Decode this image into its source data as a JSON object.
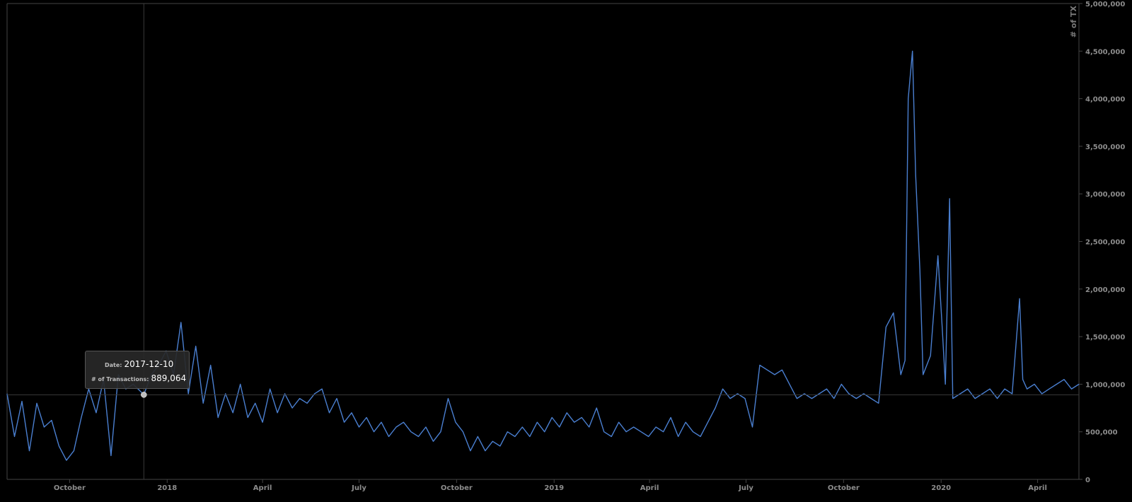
{
  "chart_data": {
    "type": "line",
    "ylabel": "# of TX",
    "ylim": [
      0,
      5000000
    ],
    "y_ticks": [
      "0",
      "500,000",
      "1,000,000",
      "1,500,000",
      "2,000,000",
      "2,500,000",
      "3,000,000",
      "3,500,000",
      "4,000,000",
      "4,500,000",
      "5,000,000"
    ],
    "y_tick_values": [
      0,
      500000,
      1000000,
      1500000,
      2000000,
      2500000,
      3000000,
      3500000,
      4000000,
      4500000,
      5000000
    ],
    "xlim": [
      "2017-08-03",
      "2020-05-10"
    ],
    "x_ticks": [
      {
        "label": "October",
        "date": "2017-10-01"
      },
      {
        "label": "2018",
        "date": "2018-01-01"
      },
      {
        "label": "April",
        "date": "2018-04-01"
      },
      {
        "label": "July",
        "date": "2018-07-01"
      },
      {
        "label": "October",
        "date": "2018-10-01"
      },
      {
        "label": "2019",
        "date": "2019-01-01"
      },
      {
        "label": "April",
        "date": "2019-04-01"
      },
      {
        "label": "July",
        "date": "2019-07-01"
      },
      {
        "label": "October",
        "date": "2019-10-01"
      },
      {
        "label": "2020",
        "date": "2020-01-01"
      },
      {
        "label": "April",
        "date": "2020-04-01"
      }
    ],
    "grid": false,
    "colors": {
      "line": "#4a7fd0",
      "crosshair": "#3a3a3a",
      "marker": "#bfbfbf",
      "axis": "#444444"
    },
    "series": [
      {
        "x": [
          "2017-08-03",
          "2017-08-10",
          "2017-08-17",
          "2017-08-24",
          "2017-08-31",
          "2017-09-07",
          "2017-09-14",
          "2017-09-21",
          "2017-09-28",
          "2017-10-05",
          "2017-10-12",
          "2017-10-19",
          "2017-10-26",
          "2017-11-02",
          "2017-11-09",
          "2017-11-16",
          "2017-11-23",
          "2017-11-30",
          "2017-12-10",
          "2017-12-17",
          "2017-12-24",
          "2017-12-31",
          "2018-01-07",
          "2018-01-14",
          "2018-01-21",
          "2018-01-28",
          "2018-02-04",
          "2018-02-11",
          "2018-02-18",
          "2018-02-25",
          "2018-03-04",
          "2018-03-11",
          "2018-03-18",
          "2018-03-25",
          "2018-04-01",
          "2018-04-08",
          "2018-04-15",
          "2018-04-22",
          "2018-04-29",
          "2018-05-06",
          "2018-05-13",
          "2018-05-20",
          "2018-05-27",
          "2018-06-03",
          "2018-06-10",
          "2018-06-17",
          "2018-06-24",
          "2018-07-01",
          "2018-07-08",
          "2018-07-15",
          "2018-07-22",
          "2018-07-29",
          "2018-08-05",
          "2018-08-12",
          "2018-08-19",
          "2018-08-26",
          "2018-09-02",
          "2018-09-09",
          "2018-09-16",
          "2018-09-23",
          "2018-09-30",
          "2018-10-07",
          "2018-10-14",
          "2018-10-21",
          "2018-10-28",
          "2018-11-04",
          "2018-11-11",
          "2018-11-18",
          "2018-11-25",
          "2018-12-02",
          "2018-12-09",
          "2018-12-16",
          "2018-12-23",
          "2018-12-30",
          "2019-01-06",
          "2019-01-13",
          "2019-01-20",
          "2019-01-27",
          "2019-02-03",
          "2019-02-10",
          "2019-02-17",
          "2019-02-24",
          "2019-03-03",
          "2019-03-10",
          "2019-03-17",
          "2019-03-24",
          "2019-03-31",
          "2019-04-07",
          "2019-04-14",
          "2019-04-21",
          "2019-04-28",
          "2019-05-05",
          "2019-05-12",
          "2019-05-19",
          "2019-05-26",
          "2019-06-02",
          "2019-06-09",
          "2019-06-16",
          "2019-06-23",
          "2019-06-30",
          "2019-07-07",
          "2019-07-14",
          "2019-07-21",
          "2019-07-28",
          "2019-08-04",
          "2019-08-11",
          "2019-08-18",
          "2019-08-25",
          "2019-09-01",
          "2019-09-08",
          "2019-09-15",
          "2019-09-22",
          "2019-09-29",
          "2019-10-06",
          "2019-10-13",
          "2019-10-20",
          "2019-10-27",
          "2019-11-03",
          "2019-11-10",
          "2019-11-17",
          "2019-11-24",
          "2019-11-28",
          "2019-12-01",
          "2019-12-05",
          "2019-12-08",
          "2019-12-12",
          "2019-12-15",
          "2019-12-22",
          "2019-12-29",
          "2020-01-02",
          "2020-01-05",
          "2020-01-09",
          "2020-01-12",
          "2020-01-19",
          "2020-01-26",
          "2020-02-02",
          "2020-02-09",
          "2020-02-16",
          "2020-02-23",
          "2020-03-01",
          "2020-03-08",
          "2020-03-15",
          "2020-03-18",
          "2020-03-22",
          "2020-03-29",
          "2020-04-05",
          "2020-04-12",
          "2020-04-19",
          "2020-04-26",
          "2020-05-03",
          "2020-05-10"
        ],
        "values": [
          900000,
          450000,
          820000,
          300000,
          800000,
          550000,
          620000,
          350000,
          200000,
          300000,
          650000,
          950000,
          700000,
          1050000,
          250000,
          1100000,
          950000,
          1000000,
          889064,
          1100000,
          1200000,
          1350000,
          1100000,
          1650000,
          900000,
          1400000,
          800000,
          1200000,
          650000,
          900000,
          700000,
          1000000,
          650000,
          800000,
          600000,
          950000,
          700000,
          900000,
          750000,
          850000,
          800000,
          900000,
          950000,
          700000,
          850000,
          600000,
          700000,
          550000,
          650000,
          500000,
          600000,
          450000,
          550000,
          600000,
          500000,
          450000,
          550000,
          400000,
          500000,
          850000,
          600000,
          500000,
          300000,
          450000,
          300000,
          400000,
          350000,
          500000,
          450000,
          550000,
          450000,
          600000,
          500000,
          650000,
          550000,
          700000,
          600000,
          650000,
          550000,
          750000,
          500000,
          450000,
          600000,
          500000,
          550000,
          500000,
          450000,
          550000,
          500000,
          650000,
          450000,
          600000,
          500000,
          450000,
          600000,
          750000,
          950000,
          850000,
          900000,
          850000,
          550000,
          1200000,
          1150000,
          1100000,
          1150000,
          1000000,
          850000,
          900000,
          850000,
          900000,
          950000,
          850000,
          1000000,
          900000,
          850000,
          900000,
          850000,
          800000,
          1600000,
          1750000,
          1100000,
          1250000,
          4000000,
          4500000,
          3200000,
          2200000,
          1100000,
          1300000,
          2350000,
          1600000,
          1000000,
          2950000,
          850000,
          900000,
          950000,
          850000,
          900000,
          950000,
          850000,
          950000,
          900000,
          1900000,
          1050000,
          950000,
          1000000,
          900000,
          950000,
          1000000,
          1050000,
          950000,
          1000000
        ]
      }
    ],
    "tooltip": {
      "date_label": "Date:",
      "date_value": "2017-12-10",
      "tx_label": "# of Transactions:",
      "tx_value": "889,064",
      "point_date": "2017-12-10",
      "point_value": 889064
    }
  }
}
